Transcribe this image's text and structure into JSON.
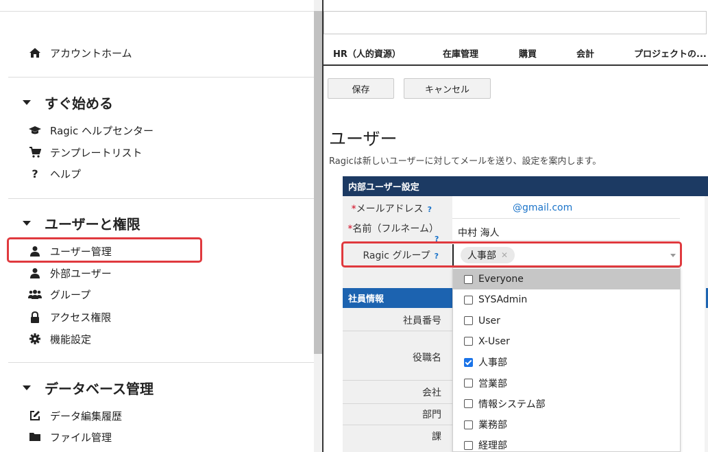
{
  "sidebar": {
    "home": "アカウントホーム",
    "sections": [
      {
        "title": "すぐ始める",
        "items": [
          "Ragic ヘルプセンター",
          "テンプレートリスト",
          "ヘルプ"
        ]
      },
      {
        "title": "ユーザーと権限",
        "items": [
          "ユーザー管理",
          "外部ユーザー",
          "グループ",
          "アクセス権限",
          "機能設定"
        ]
      },
      {
        "title": "データベース管理",
        "items": [
          "データ編集履歴",
          "ファイル管理"
        ]
      }
    ]
  },
  "tabs": [
    "HR（人的資源）",
    "在庫管理",
    "購買",
    "会計",
    "プロジェクトの..."
  ],
  "toolbar": {
    "save_label": "保存",
    "cancel_label": "キャンセル"
  },
  "page": {
    "title": "ユーザー",
    "description": "Ragicは新しいユーザーに対してメールを送り、設定を案内します。"
  },
  "form": {
    "header": "内部ユーザー設定",
    "email_label": "メールアドレス",
    "email_value": "@gmail.com",
    "name_label": "名前（フルネーム）",
    "name_value": "中村 海人",
    "group_label": "Ragic グループ",
    "group_tag": "人事部",
    "help_mark": "?",
    "required_mark": "*"
  },
  "employee": {
    "header": "社員情報",
    "fields": [
      "社員番号",
      "役職名",
      "会社",
      "部門",
      "課"
    ]
  },
  "group_options": [
    {
      "label": "Everyone",
      "checked": false,
      "hover": true
    },
    {
      "label": "SYSAdmin",
      "checked": false
    },
    {
      "label": "User",
      "checked": false
    },
    {
      "label": "X-User",
      "checked": false
    },
    {
      "label": "人事部",
      "checked": true
    },
    {
      "label": "営業部",
      "checked": false
    },
    {
      "label": "情報システム部",
      "checked": false
    },
    {
      "label": "業務部",
      "checked": false
    },
    {
      "label": "経理部",
      "checked": false
    }
  ],
  "colors": {
    "header_navy": "#1c3a63",
    "section_blue": "#1c63b0",
    "highlight_red": "#e0393e",
    "link_blue": "#1a73c9"
  }
}
